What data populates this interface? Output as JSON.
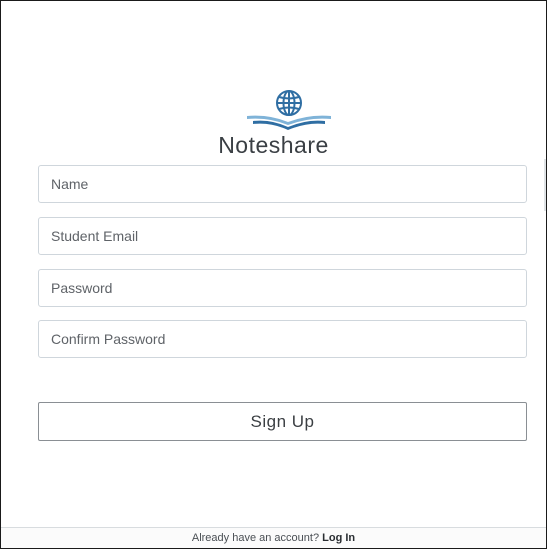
{
  "app": {
    "title": "Noteshare",
    "logo_icon": "globe-book-icon",
    "brand_color": "#2f6ea3"
  },
  "form": {
    "name_placeholder": "Name",
    "email_placeholder": "Student Email",
    "password_placeholder": "Password",
    "confirm_placeholder": "Confirm Password",
    "submit_label": "Sign Up"
  },
  "footer": {
    "prompt": "Already have an account?",
    "login_label": "Log In"
  }
}
